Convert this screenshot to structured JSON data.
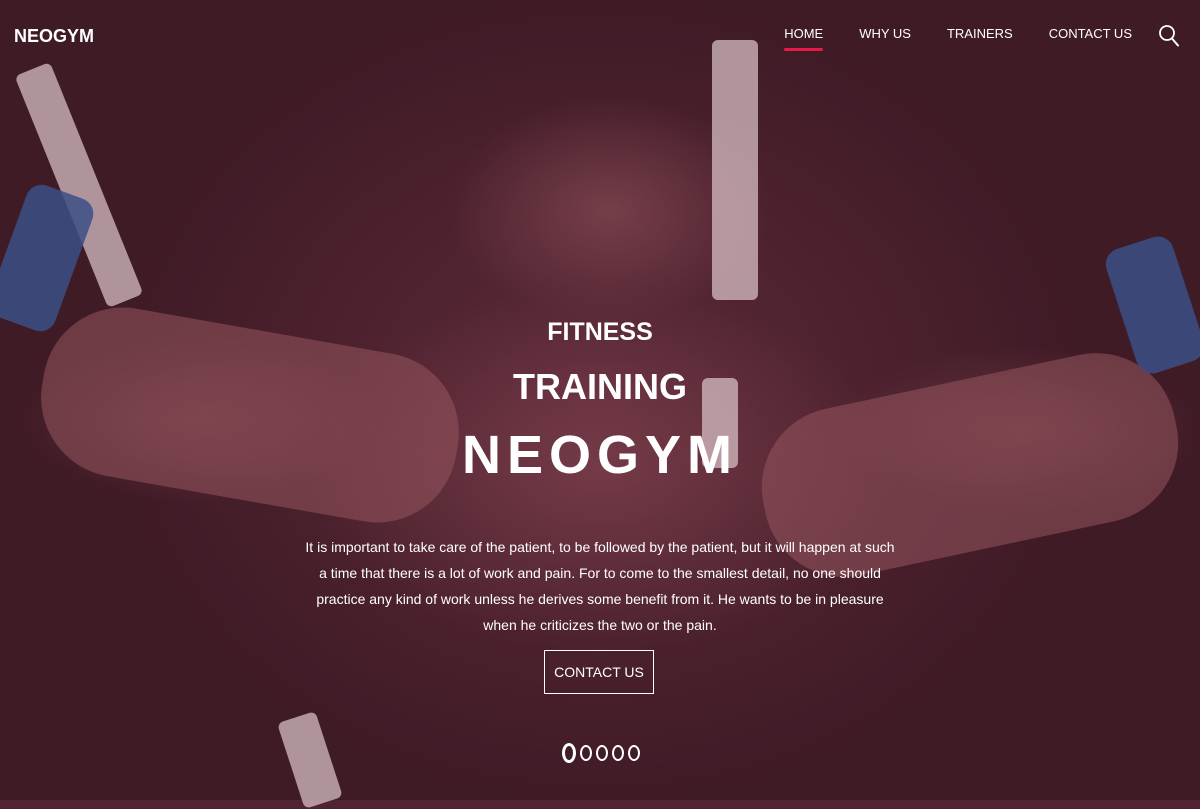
{
  "brand": "NEOGYM",
  "nav": {
    "items": [
      {
        "label": "HOME",
        "active": true
      },
      {
        "label": "WHY US",
        "active": false
      },
      {
        "label": "TRAINERS",
        "active": false
      },
      {
        "label": "CONTACT US",
        "active": false
      }
    ],
    "search_icon": "search-icon"
  },
  "hero": {
    "line1": "FITNESS",
    "line2": "TRAINING",
    "line3": "NEOGYM",
    "description": "It is important to take care of the patient, to be followed by the patient, but it will happen at such a time that there is a lot of work and pain. For to come to the smallest detail, no one should practice any kind of work unless he derives some benefit from it. He wants to be in pleasure when he criticizes the two or the pain.",
    "cta_label": "CONTACT US",
    "slides": 5,
    "active_slide": 1
  },
  "colors": {
    "overlay": "#4f2330",
    "accent": "#e8194a",
    "text": "#ffffff"
  }
}
